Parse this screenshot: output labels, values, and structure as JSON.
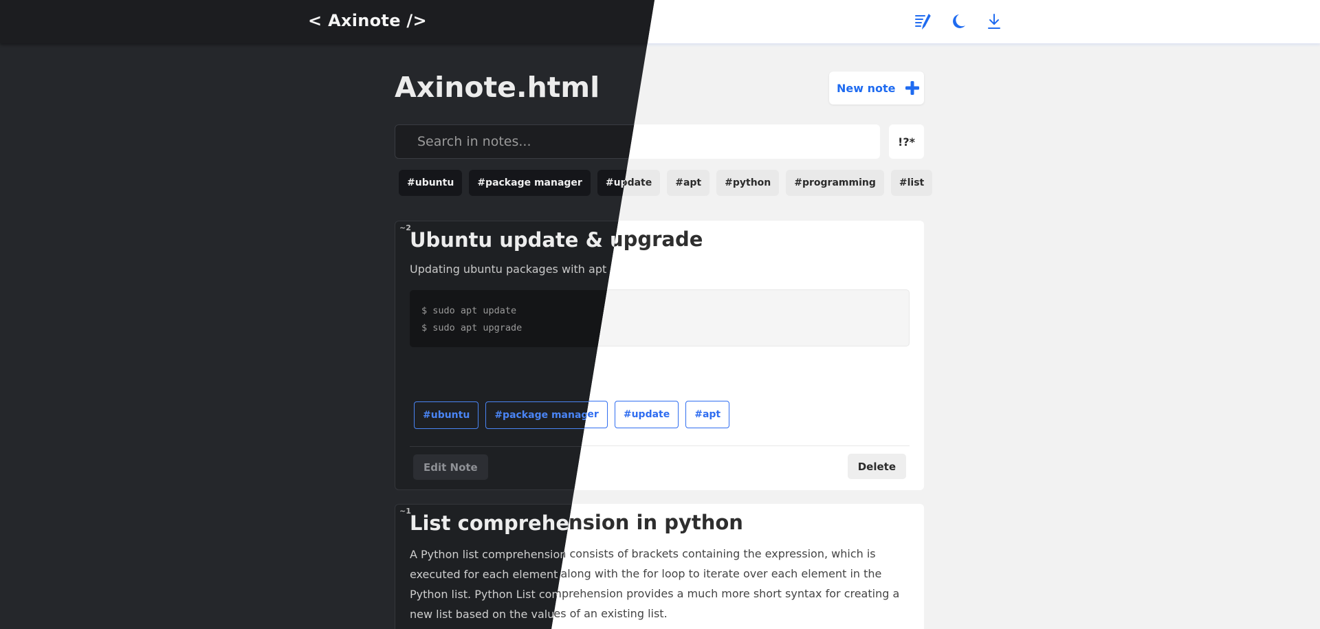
{
  "app": {
    "logo": "< Axinote />"
  },
  "header": {
    "icons": [
      "notes-icon",
      "moon-icon",
      "download-icon"
    ],
    "accent_color": "#1f6bf0"
  },
  "page": {
    "title": "Axinote.html",
    "new_note_label": "New note"
  },
  "search": {
    "placeholder": "Search in notes...",
    "value": "",
    "regex_label": "!?*"
  },
  "tag_filters": [
    "#ubuntu",
    "#package manager",
    "#update",
    "#apt",
    "#python",
    "#programming",
    "#list"
  ],
  "notes": [
    {
      "order": "~2",
      "title": "Ubuntu update & upgrade",
      "description": "Updating ubuntu packages with apt",
      "code_lines": [
        "$ sudo apt update",
        "$ sudo apt upgrade"
      ],
      "tags": [
        "#ubuntu",
        "#package manager",
        "#update",
        "#apt"
      ],
      "edit_label": "Edit Note",
      "delete_label": "Delete"
    },
    {
      "order": "~1",
      "title": "List comprehension in python",
      "body": "A Python list comprehension consists of brackets containing the expression, which is executed for each element along with the for loop to iterate over each element in the Python list. Python List comprehension provides a much more short syntax for creating a new list based on the values of an existing list."
    }
  ]
}
